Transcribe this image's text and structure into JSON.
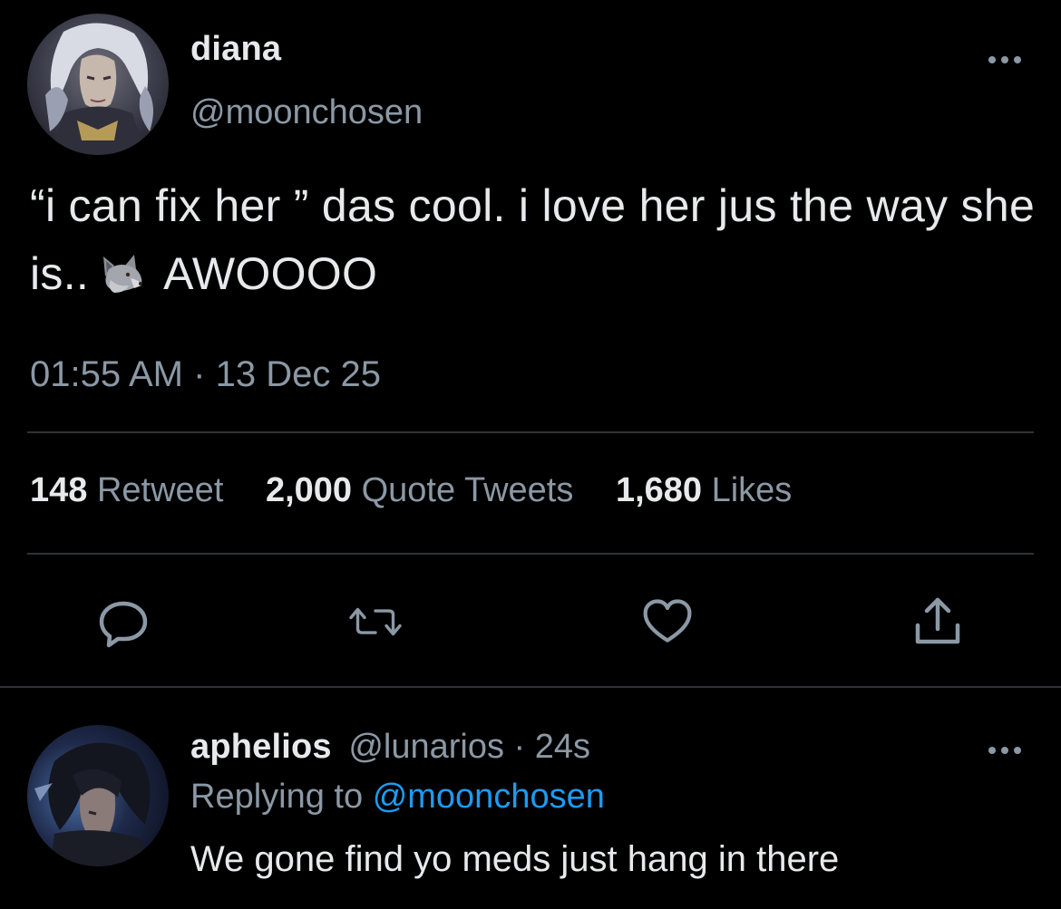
{
  "tweet": {
    "display_name": "diana",
    "handle": "@moonchosen",
    "text_before_emoji": "“i can fix her ” das cool. i love her jus the way she is..",
    "emoji_icon": "wolf-emoji",
    "text_after_emoji": "AWOOOO",
    "time": "01:55 AM",
    "separator": "·",
    "date": "13 Dec 25",
    "stats": [
      {
        "count": "148",
        "label": "Retweet"
      },
      {
        "count": "2,000",
        "label": "Quote Tweets"
      },
      {
        "count": "1,680",
        "label": "Likes"
      }
    ],
    "actions": [
      "reply-icon",
      "retweet-icon",
      "like-icon",
      "share-icon"
    ]
  },
  "reply": {
    "display_name": "aphelios",
    "handle": "@lunarios",
    "separator": "·",
    "age": "24s",
    "replying_prefix": "Replying to",
    "replying_to": "@moonchosen",
    "text": "We gone find yo meds just hang in there"
  },
  "colors": {
    "background": "#000000",
    "primary_text": "#e7e9ea",
    "secondary_text": "#8b98a5",
    "divider": "#2f3336",
    "link": "#1d9bf0"
  }
}
